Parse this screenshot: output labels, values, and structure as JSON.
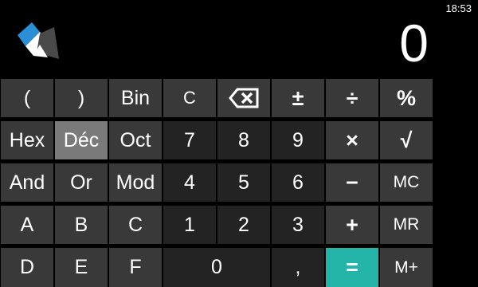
{
  "status": {
    "time": "18:53"
  },
  "display": {
    "value": "0"
  },
  "logo": {
    "icon": "windows-logo-icon"
  },
  "colors": {
    "accent": "#25b4a8",
    "selected": "#7a7a7a",
    "function_key": "#393939",
    "number_key": "#232323"
  },
  "keys": {
    "paren_open": "(",
    "paren_close": ")",
    "bin": "Bin",
    "clear": "C",
    "backspace": "backspace-icon",
    "plus_minus": "±",
    "divide": "÷",
    "percent": "%",
    "hex": "Hex",
    "dec": "Déc",
    "oct": "Oct",
    "n7": "7",
    "n8": "8",
    "n9": "9",
    "multiply": "×",
    "sqrt": "√",
    "and": "And",
    "or": "Or",
    "mod": "Mod",
    "n4": "4",
    "n5": "5",
    "n6": "6",
    "minus": "−",
    "mc": "MC",
    "hexA": "A",
    "hexB": "B",
    "hexC": "C",
    "n1": "1",
    "n2": "2",
    "n3": "3",
    "plus": "+",
    "mr": "MR",
    "hexD": "D",
    "hexE": "E",
    "hexF": "F",
    "n0": "0",
    "comma": ",",
    "equals": "=",
    "mplus": "M+"
  }
}
